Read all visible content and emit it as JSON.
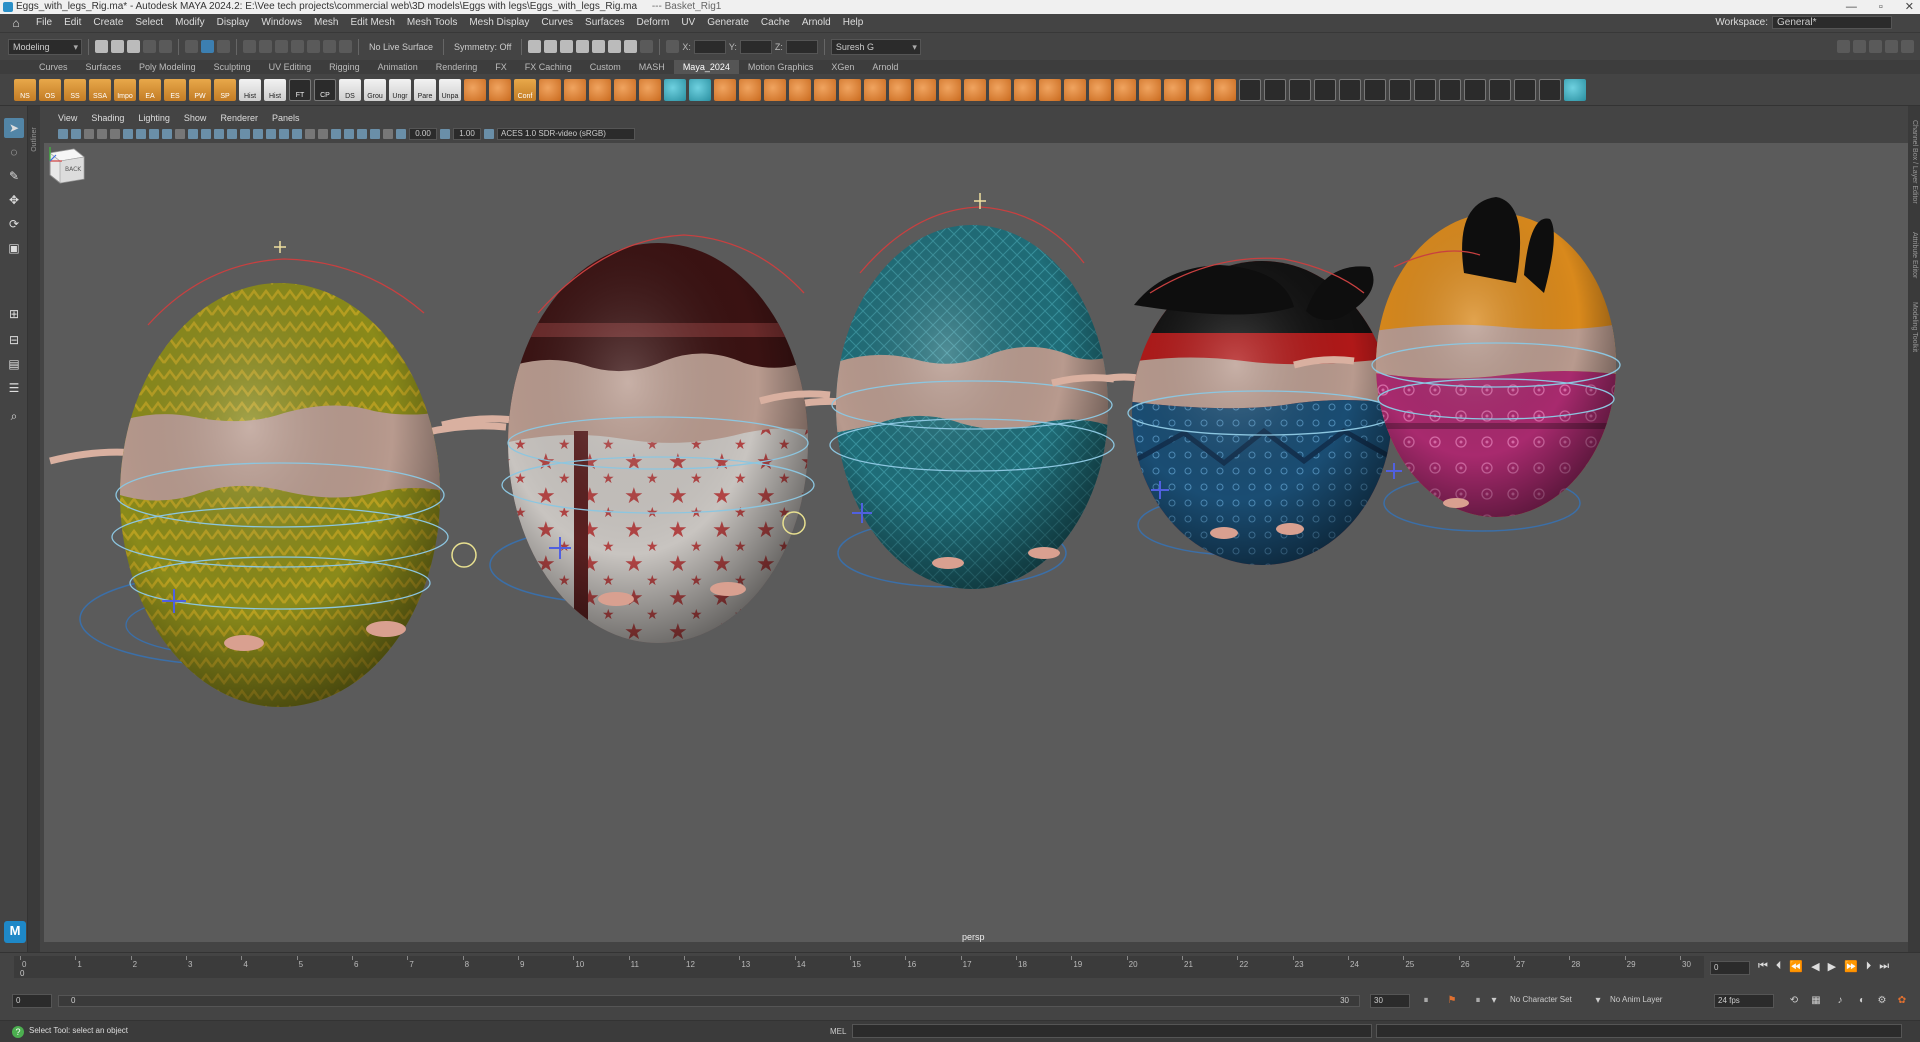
{
  "window": {
    "title": "Eggs_with_legs_Rig.ma* - Autodesk MAYA 2024.2: E:\\Vee tech projects\\commercial web\\3D models\\Eggs with legs\\Eggs_with_legs_Rig.ma",
    "extra": "---   Basket_Rig1",
    "min_glyph": "—",
    "max_glyph": "▫",
    "close_glyph": "✕"
  },
  "menus": [
    "File",
    "Edit",
    "Create",
    "Select",
    "Modify",
    "Display",
    "Windows",
    "Mesh",
    "Edit Mesh",
    "Mesh Tools",
    "Mesh Display",
    "Curves",
    "Surfaces",
    "Deform",
    "UV",
    "Generate",
    "Cache",
    "Arnold",
    "Help"
  ],
  "workspace": {
    "label": "Workspace:",
    "value": "General*"
  },
  "status": {
    "mode": "Modeling",
    "live_surface": "No Live Surface",
    "symmetry": "Symmetry: Off",
    "x_label": "X:",
    "y_label": "Y:",
    "z_label": "Z:",
    "user": "Suresh G"
  },
  "shelf_tabs": [
    "Curves",
    "Surfaces",
    "Poly Modeling",
    "Sculpting",
    "UV Editing",
    "Rigging",
    "Animation",
    "Rendering",
    "FX",
    "FX Caching",
    "Custom",
    "MASH",
    "Maya_2024",
    "Motion Graphics",
    "XGen",
    "Arnold"
  ],
  "shelf_active": "Maya_2024",
  "shelf_buttons": [
    "NS",
    "OS",
    "SS",
    "SSA",
    "Impo",
    "EA",
    "ES",
    "PW",
    "SP",
    "Hist",
    "Hist",
    "FT",
    "CP",
    "DS",
    "Grou",
    "Ungr",
    "Pare",
    "Unpa",
    "",
    "Conf"
  ],
  "panel_menu": [
    "View",
    "Shading",
    "Lighting",
    "Show",
    "Renderer",
    "Panels"
  ],
  "panel_tools": {
    "exposure": "0.00",
    "gamma": "1.00",
    "color_space": "ACES 1.0 SDR-video (sRGB)"
  },
  "viewport": {
    "camera": "persp",
    "viewcube": "BACK"
  },
  "outliner_label": "Outliner",
  "right_tabs": [
    "Channel Box / Layer Editor",
    "Attribute Editor",
    "Modeling Toolkit"
  ],
  "timeline": {
    "ticks": [
      0,
      1,
      2,
      3,
      4,
      5,
      6,
      7,
      8,
      9,
      10,
      11,
      12,
      13,
      14,
      15,
      16,
      17,
      18,
      19,
      20,
      21,
      22,
      23,
      24,
      25,
      26,
      27,
      28,
      29,
      30
    ],
    "current_frame_marker": "0",
    "current_frame": "0"
  },
  "range": {
    "start": "0",
    "inner_start": "0",
    "inner_end": "30",
    "end": "30",
    "character_set": "No Character Set",
    "anim_layer": "No Anim Layer",
    "fps": "24 fps"
  },
  "help": {
    "text": "Select Tool: select an object",
    "mel": "MEL"
  },
  "logo": "M",
  "eggs": [
    {
      "top": "#8a8a1a",
      "band": "#b89a8e",
      "bottom": "#8a8a1a"
    },
    {
      "top": "#3a1212",
      "band": "#b89a8e",
      "bottom": "#c8c4c0"
    },
    {
      "top": "#1f6d78",
      "band": "#b89a8e",
      "bottom": "#1f6d78"
    },
    {
      "top": "#b01818",
      "band": "#b89a8e",
      "bottom": "#1a4d73"
    },
    {
      "top": "#d9891c",
      "band": "#b89a8e",
      "bottom": "#a82a6e"
    }
  ]
}
